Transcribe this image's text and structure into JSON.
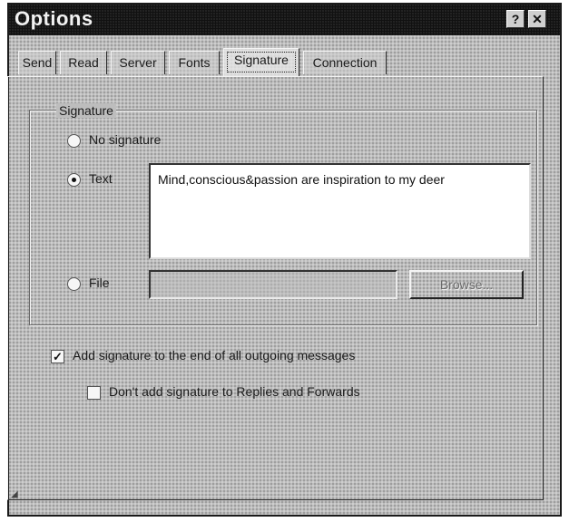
{
  "window": {
    "title": "Options",
    "help_glyph": "?",
    "close_glyph": "✕"
  },
  "tabs": [
    {
      "label": "Send",
      "active": false
    },
    {
      "label": "Read",
      "active": false
    },
    {
      "label": "Server",
      "active": false
    },
    {
      "label": "Fonts",
      "active": false
    },
    {
      "label": "Signature",
      "active": true
    },
    {
      "label": "Connection",
      "active": false
    }
  ],
  "signature": {
    "group_label": "Signature",
    "no_signature_label": "No signature",
    "text_label": "Text",
    "text_value": "Mind,conscious&passion are inspiration to my deer",
    "file_label": "File",
    "file_value": "",
    "browse_label": "Browse...",
    "selected": "text"
  },
  "options": {
    "add_signature_label": "Add signature to the end of all outgoing messages",
    "add_signature_checked": true,
    "dont_add_label": "Don't add signature to Replies and Forwards",
    "dont_add_checked": false
  },
  "icons": {
    "help": "help-icon",
    "close": "close-icon",
    "check": "check-icon"
  }
}
